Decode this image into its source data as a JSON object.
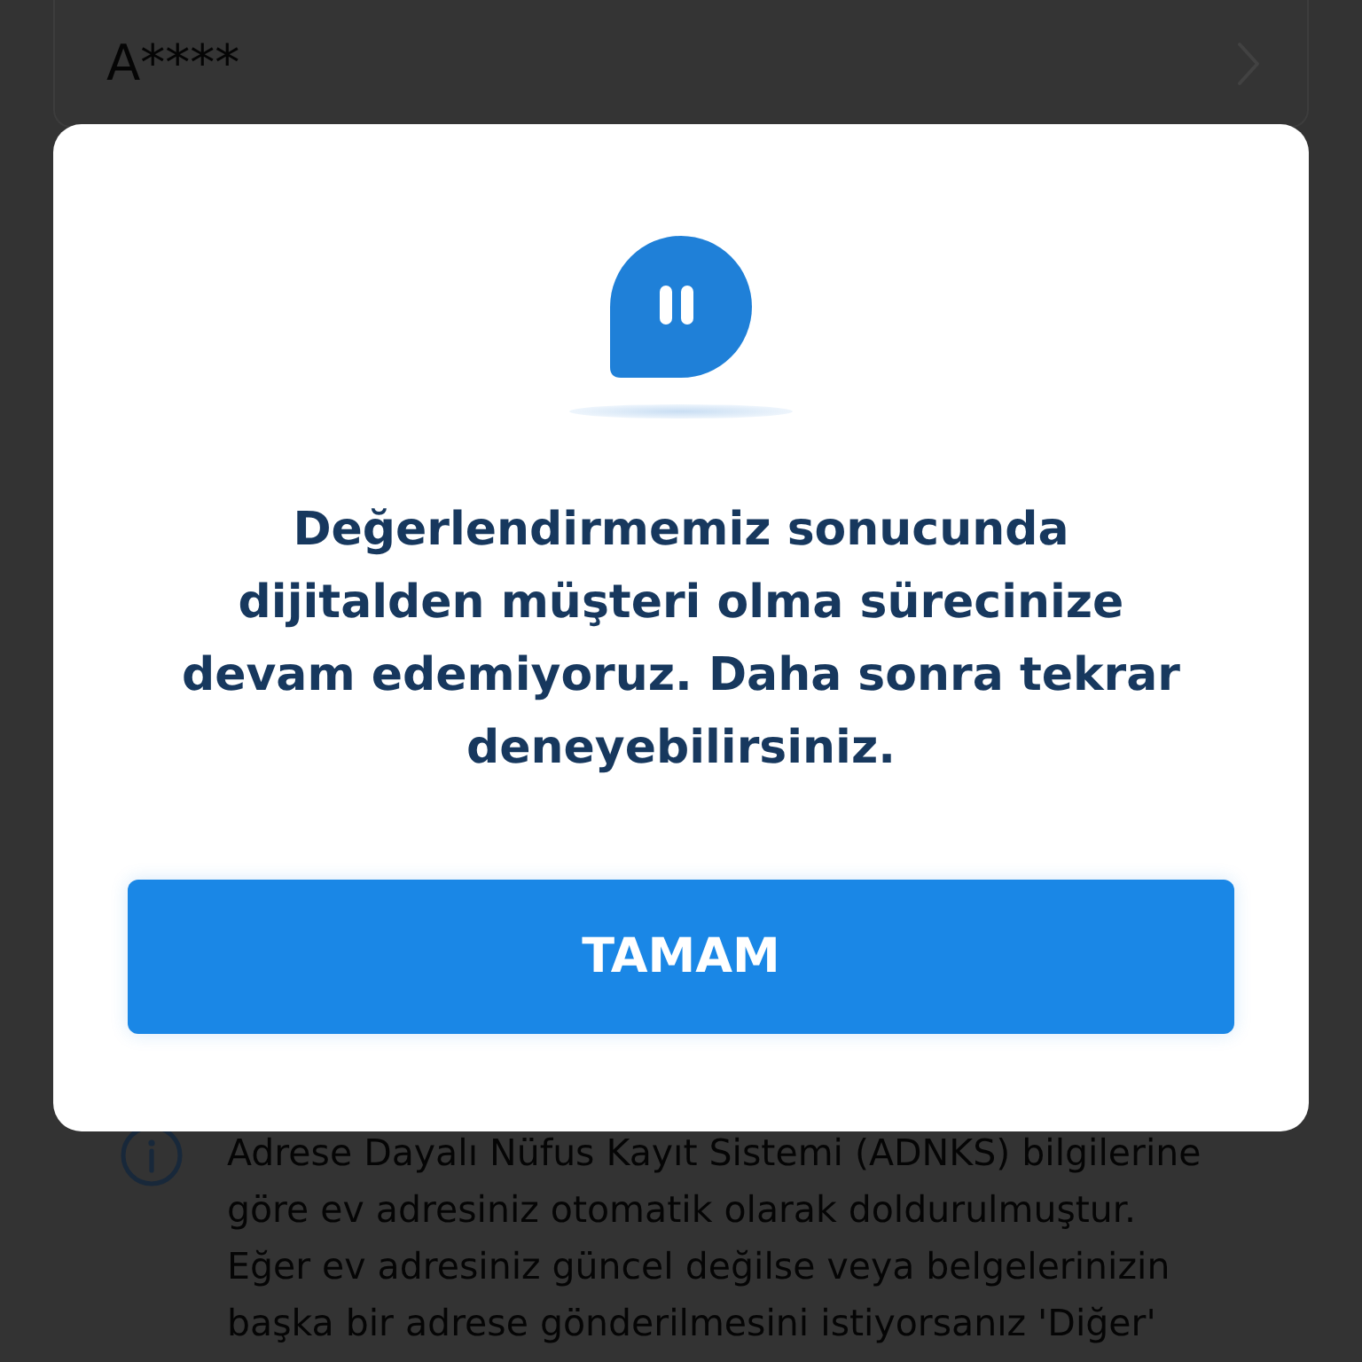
{
  "background": {
    "card": {
      "title": "A****"
    },
    "info_note": {
      "text": "Adrese Dayalı Nüfus Kayıt Sistemi (ADNKS) bilgilerine göre ev adresiniz otomatik olarak doldurulmuştur. Eğer ev adresiniz güncel değilse veya belgelerinizin başka bir adrese gönderilmesini istiyorsanız 'Diğer'"
    }
  },
  "dialog": {
    "message": "Değerlendirmemiz sonucunda dijitalden müşteri olma sürecinize devam edemiyoruz. Daha sonra tekrar deneyebilirsiniz.",
    "button": "TAMAM"
  }
}
